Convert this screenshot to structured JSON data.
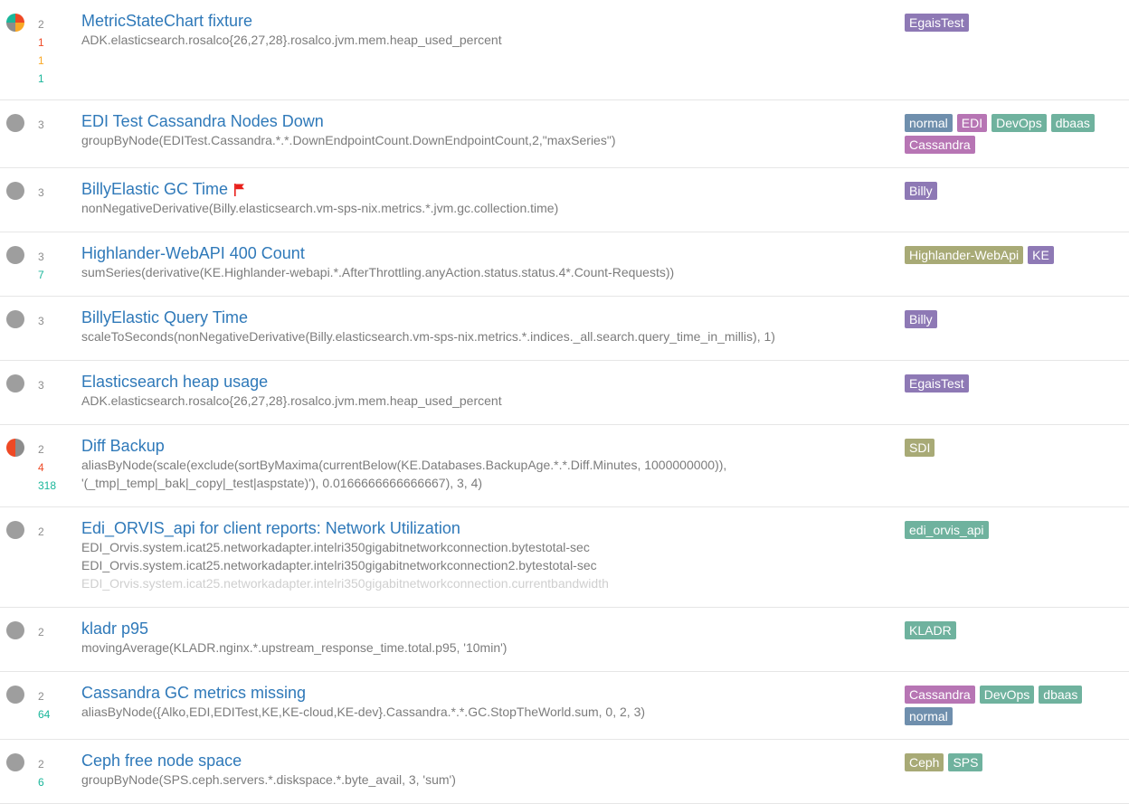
{
  "colors": {
    "link": "#2f79b9",
    "count_default": "#8c8c8c",
    "count_error": "#ee4925",
    "count_warn": "#f9a825",
    "count_ok": "#1ab69a",
    "pie_nodata": "#9e9e9e",
    "tag_purple": "#8e79b5",
    "tag_pink": "#b775b4",
    "tag_teal": "#6fb29e",
    "tag_slate": "#6f8fad",
    "tag_olive": "#a8aa76"
  },
  "rows": [
    {
      "title": "MetricStateChart fixture",
      "pie": {
        "kind": "mixed",
        "icon": "mixed-status-pie-icon",
        "slices": [
          {
            "color": "#ee4925",
            "fraction": 0.25
          },
          {
            "color": "#f9a825",
            "fraction": 0.25
          },
          {
            "color": "#8c8c8c",
            "fraction": 0.25
          },
          {
            "color": "#1ab69a",
            "fraction": 0.25
          }
        ]
      },
      "counts": [
        {
          "value": "2",
          "color": "#8c8c8c"
        },
        {
          "value": "1",
          "color": "#ee4925"
        },
        {
          "value": "1",
          "color": "#f9a825"
        },
        {
          "value": "1",
          "color": "#1ab69a"
        }
      ],
      "targets": [
        {
          "text": "ADK.elasticsearch.rosalco{26,27,28}.rosalco.jvm.mem.heap_used_percent",
          "faded": false
        }
      ],
      "flag": false,
      "tags": [
        {
          "label": "EgaisTest",
          "color": "#8e79b5"
        }
      ]
    },
    {
      "title": "EDI Test Cassandra Nodes Down",
      "pie": {
        "kind": "nodata",
        "icon": "nodata-status-icon"
      },
      "counts": [
        {
          "value": "3",
          "color": "#8c8c8c"
        }
      ],
      "targets": [
        {
          "text": "groupByNode(EDITest.Cassandra.*.*.DownEndpointCount.DownEndpointCount,2,\"maxSeries\")",
          "faded": false
        }
      ],
      "flag": false,
      "tags": [
        {
          "label": "normal",
          "color": "#6f8fad"
        },
        {
          "label": "EDI",
          "color": "#b775b4"
        },
        {
          "label": "DevOps",
          "color": "#6fb29e"
        },
        {
          "label": "dbaas",
          "color": "#6fb29e"
        },
        {
          "label": "Cassandra",
          "color": "#b775b4"
        }
      ]
    },
    {
      "title": "BillyElastic GC Time",
      "pie": {
        "kind": "nodata",
        "icon": "nodata-status-icon"
      },
      "counts": [
        {
          "value": "3",
          "color": "#8c8c8c"
        }
      ],
      "targets": [
        {
          "text": "nonNegativeDerivative(Billy.elasticsearch.vm-sps-nix.metrics.*.jvm.gc.collection.time)",
          "faded": false
        }
      ],
      "flag": true,
      "tags": [
        {
          "label": "Billy",
          "color": "#8e79b5"
        }
      ]
    },
    {
      "title": "Highlander-WebAPI 400 Count",
      "pie": {
        "kind": "nodata",
        "icon": "nodata-status-icon"
      },
      "counts": [
        {
          "value": "3",
          "color": "#8c8c8c"
        },
        {
          "value": "7",
          "color": "#1ab69a"
        }
      ],
      "targets": [
        {
          "text": "sumSeries(derivative(KE.Highlander-webapi.*.AfterThrottling.anyAction.status.status.4*.Count-Requests))",
          "faded": false
        }
      ],
      "flag": false,
      "tags": [
        {
          "label": "Highlander-WebApi",
          "color": "#a8aa76"
        },
        {
          "label": "KE",
          "color": "#8e79b5"
        }
      ]
    },
    {
      "title": "BillyElastic Query Time",
      "pie": {
        "kind": "nodata",
        "icon": "nodata-status-icon"
      },
      "counts": [
        {
          "value": "3",
          "color": "#8c8c8c"
        }
      ],
      "targets": [
        {
          "text": "scaleToSeconds(nonNegativeDerivative(Billy.elasticsearch.vm-sps-nix.metrics.*.indices._all.search.query_time_in_millis), 1)",
          "faded": false
        }
      ],
      "flag": false,
      "tags": [
        {
          "label": "Billy",
          "color": "#8e79b5"
        }
      ]
    },
    {
      "title": "Elasticsearch heap usage",
      "pie": {
        "kind": "nodata",
        "icon": "nodata-status-icon"
      },
      "counts": [
        {
          "value": "3",
          "color": "#8c8c8c"
        }
      ],
      "targets": [
        {
          "text": "ADK.elasticsearch.rosalco{26,27,28}.rosalco.jvm.mem.heap_used_percent",
          "faded": false
        }
      ],
      "flag": false,
      "tags": [
        {
          "label": "EgaisTest",
          "color": "#8e79b5"
        }
      ]
    },
    {
      "title": "Diff Backup",
      "pie": {
        "kind": "mixed",
        "icon": "mixed-status-pie-icon",
        "slices": [
          {
            "color": "#8c8c8c",
            "fraction": 0.5
          },
          {
            "color": "#ee4925",
            "fraction": 0.5
          }
        ]
      },
      "counts": [
        {
          "value": "2",
          "color": "#8c8c8c"
        },
        {
          "value": "4",
          "color": "#ee4925"
        },
        {
          "value": "318",
          "color": "#1ab69a"
        }
      ],
      "targets": [
        {
          "text": "aliasByNode(scale(exclude(sortByMaxima(currentBelow(KE.Databases.BackupAge.*.*.Diff.Minutes, 1000000000)), '(_tmp|_temp|_bak|_copy|_test|aspstate)'), 0.0166666666666667), 3, 4)",
          "faded": false
        }
      ],
      "flag": false,
      "tags": [
        {
          "label": "SDI",
          "color": "#a8aa76"
        }
      ]
    },
    {
      "title": "Edi_ORVIS_api for client reports: Network Utilization",
      "pie": {
        "kind": "nodata",
        "icon": "nodata-status-icon"
      },
      "counts": [
        {
          "value": "2",
          "color": "#8c8c8c"
        }
      ],
      "targets": [
        {
          "text": "EDI_Orvis.system.icat25.networkadapter.intelri350gigabitnetworkconnection.bytestotal-sec",
          "faded": false
        },
        {
          "text": "EDI_Orvis.system.icat25.networkadapter.intelri350gigabitnetworkconnection2.bytestotal-sec",
          "faded": false
        },
        {
          "text": "EDI_Orvis.system.icat25.networkadapter.intelri350gigabitnetworkconnection.currentbandwidth",
          "faded": true
        }
      ],
      "flag": false,
      "tags": [
        {
          "label": "edi_orvis_api",
          "color": "#6fb29e"
        }
      ]
    },
    {
      "title": "kladr p95",
      "pie": {
        "kind": "nodata",
        "icon": "nodata-status-icon"
      },
      "counts": [
        {
          "value": "2",
          "color": "#8c8c8c"
        }
      ],
      "targets": [
        {
          "text": "movingAverage(KLADR.nginx.*.upstream_response_time.total.p95, '10min')",
          "faded": false
        }
      ],
      "flag": false,
      "tags": [
        {
          "label": "KLADR",
          "color": "#6fb29e"
        }
      ]
    },
    {
      "title": "Cassandra GC metrics missing",
      "pie": {
        "kind": "nodata",
        "icon": "nodata-status-icon"
      },
      "counts": [
        {
          "value": "2",
          "color": "#8c8c8c"
        },
        {
          "value": "64",
          "color": "#1ab69a"
        }
      ],
      "targets": [
        {
          "text": "aliasByNode({Alko,EDI,EDITest,KE,KE-cloud,KE-dev}.Cassandra.*.*.GC.StopTheWorld.sum, 0, 2, 3)",
          "faded": false
        }
      ],
      "flag": false,
      "tags": [
        {
          "label": "Cassandra",
          "color": "#b775b4"
        },
        {
          "label": "DevOps",
          "color": "#6fb29e"
        },
        {
          "label": "dbaas",
          "color": "#6fb29e"
        },
        {
          "label": "normal",
          "color": "#6f8fad"
        }
      ]
    },
    {
      "title": "Ceph free node space",
      "pie": {
        "kind": "nodata",
        "icon": "nodata-status-icon"
      },
      "counts": [
        {
          "value": "2",
          "color": "#8c8c8c"
        },
        {
          "value": "6",
          "color": "#1ab69a"
        }
      ],
      "targets": [
        {
          "text": "groupByNode(SPS.ceph.servers.*.diskspace.*.byte_avail, 3, 'sum')",
          "faded": false
        }
      ],
      "flag": false,
      "tags": [
        {
          "label": "Ceph",
          "color": "#a8aa76"
        },
        {
          "label": "SPS",
          "color": "#6fb29e"
        }
      ]
    }
  ]
}
